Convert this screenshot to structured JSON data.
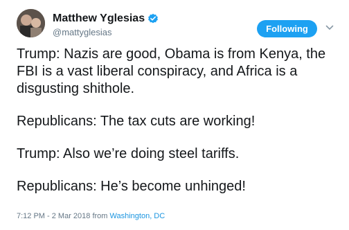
{
  "author": {
    "name": "Matthew Yglesias",
    "handle": "@mattyglesias",
    "verified": true
  },
  "follow_button": {
    "label": "Following"
  },
  "menu": {
    "icon": "chevron-down-icon"
  },
  "tweet": {
    "paragraphs": [
      "Trump: Nazis are good, Obama is from Kenya, the FBI is a vast liberal conspiracy, and Africa is a disgusting shithole.",
      "Republicans: The tax cuts are working!",
      "Trump: Also we’re doing steel tariffs.",
      "Republicans: He’s become unhinged!"
    ]
  },
  "meta": {
    "timestamp": "7:12 PM - 2 Mar 2018",
    "from_label": "from",
    "location": "Washington, DC"
  },
  "colors": {
    "accent": "#1da1f2",
    "link": "#1b95e0",
    "secondary_text": "#657786",
    "primary_text": "#14171a"
  }
}
